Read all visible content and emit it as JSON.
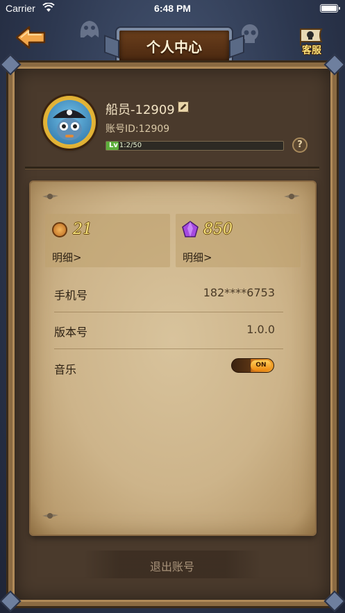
{
  "status_bar": {
    "carrier": "Carrier",
    "time": "6:48 PM"
  },
  "header": {
    "title": "个人中心",
    "service_label": "客服"
  },
  "profile": {
    "username": "船员-12909",
    "account_id": "账号ID:12909",
    "level_badge": "Lv",
    "level_progress": "1:2/50",
    "exp_fraction": 0.04
  },
  "currency": {
    "coins": {
      "value": "21",
      "detail": "明细>"
    },
    "gems": {
      "value": "850",
      "detail": "明细>"
    }
  },
  "settings": {
    "phone": {
      "label": "手机号",
      "value": "182****6753"
    },
    "version": {
      "label": "版本号",
      "value": "1.0.0"
    },
    "music": {
      "label": "音乐",
      "toggle": "ON",
      "enabled": true
    }
  },
  "logout_label": "退出账号",
  "icons": {
    "back": "back-arrow-icon",
    "service": "pirate-flag-icon",
    "edit": "edit-icon",
    "help": "question-icon",
    "coin": "coin-icon",
    "gem": "gem-icon"
  },
  "colors": {
    "accent": "#f0a02a",
    "parchment": "#d8c39c",
    "frame": "#8a6a42",
    "exp": "#5cae3a"
  }
}
